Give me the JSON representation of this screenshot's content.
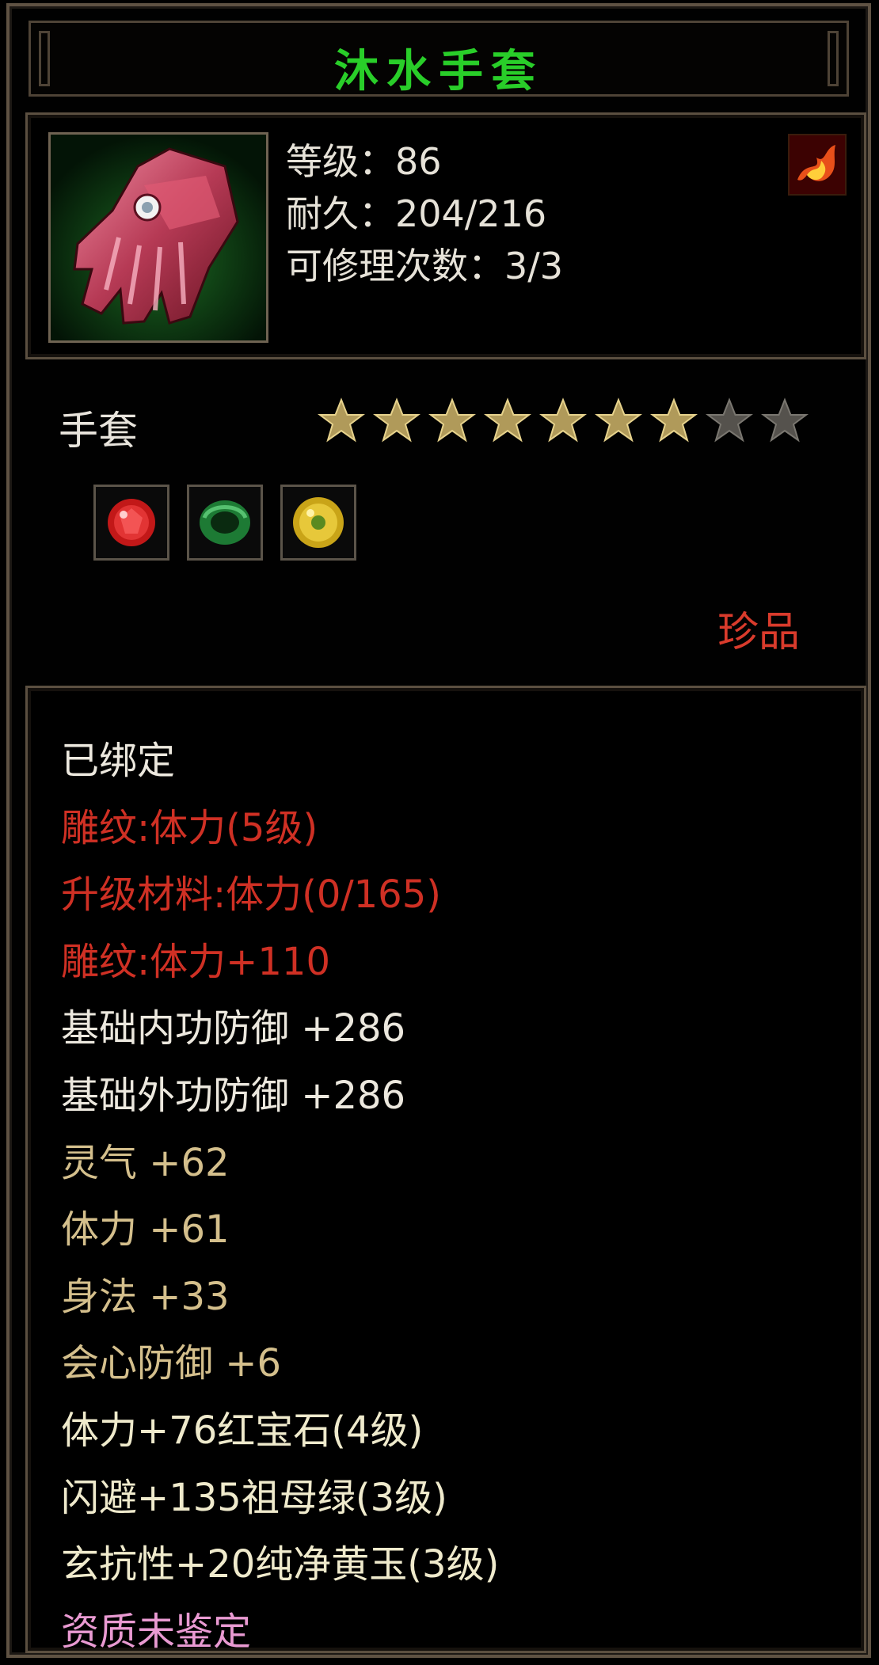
{
  "tooltip": {
    "title": "沐水手套",
    "stats": {
      "level_label": "等级：",
      "level_value": "86",
      "durability_label": "耐久：",
      "durability_value": "204/216",
      "repair_label": "可修理次数：",
      "repair_value": "3/3"
    },
    "category": "手套",
    "stars": {
      "filled": 7,
      "total": 9
    },
    "gems": [
      {
        "icon": "red-ruby-icon"
      },
      {
        "icon": "emerald-ring-icon"
      },
      {
        "icon": "yellow-jade-icon"
      }
    ],
    "rarity": "珍品",
    "attributes": [
      {
        "text": "已绑定",
        "color": "white"
      },
      {
        "text": "雕纹:体力(5级)",
        "color": "red"
      },
      {
        "text": "升级材料:体力(0/165)",
        "color": "red"
      },
      {
        "text": "雕纹:体力+110",
        "color": "red"
      },
      {
        "text": "基础内功防御 +286",
        "color": "white"
      },
      {
        "text": "基础外功防御 +286",
        "color": "white"
      },
      {
        "text": "灵气 +62",
        "color": "gold"
      },
      {
        "text": "体力 +61",
        "color": "gold"
      },
      {
        "text": "身法 +33",
        "color": "gold"
      },
      {
        "text": "会心防御 +6",
        "color": "gold"
      },
      {
        "text": "体力+76红宝石(4级)",
        "color": "cream"
      },
      {
        "text": "闪避+135祖母绿(3级)",
        "color": "cream"
      },
      {
        "text": "玄抗性+20纯净黄玉(3级)",
        "color": "cream"
      },
      {
        "text": "资质未鉴定",
        "color": "pink"
      }
    ],
    "colors": {
      "title": "#29ce29",
      "rarity": "#d93b2c",
      "star_filled": "#b09a5a",
      "star_empty": "#55524d"
    }
  }
}
